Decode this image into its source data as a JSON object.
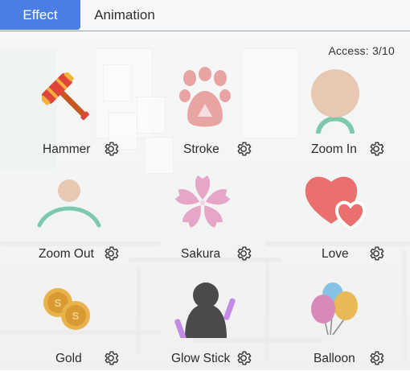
{
  "tabs": [
    {
      "label": "Effect",
      "active": true
    },
    {
      "label": "Animation",
      "active": false
    }
  ],
  "access": "Access:  3/10",
  "effects": [
    {
      "name": "Hammer",
      "icon": "hammer-icon"
    },
    {
      "name": "Stroke",
      "icon": "paw-icon"
    },
    {
      "name": "Zoom In",
      "icon": "zoom-in-avatar-icon"
    },
    {
      "name": "Zoom Out",
      "icon": "zoom-out-avatar-icon"
    },
    {
      "name": "Sakura",
      "icon": "sakura-icon"
    },
    {
      "name": "Love",
      "icon": "hearts-icon"
    },
    {
      "name": "Gold",
      "icon": "gold-coins-icon"
    },
    {
      "name": "Glow Stick",
      "icon": "glow-stick-icon"
    },
    {
      "name": "Balloon",
      "icon": "balloons-icon"
    }
  ],
  "colors": {
    "accent": "#4a7ee2",
    "hammer_red": "#e0453c",
    "paw": "#e8a4a2",
    "skin": "#e6c8b3",
    "mint": "#7cc9ad",
    "sakura": "#e6a6c8",
    "heart": "#e9706f",
    "gold": "#e9b24a",
    "glow": "#c48ae6",
    "balloon_blue": "#86c1e6",
    "balloon_pink": "#d889b7",
    "balloon_yellow": "#e9b955"
  }
}
